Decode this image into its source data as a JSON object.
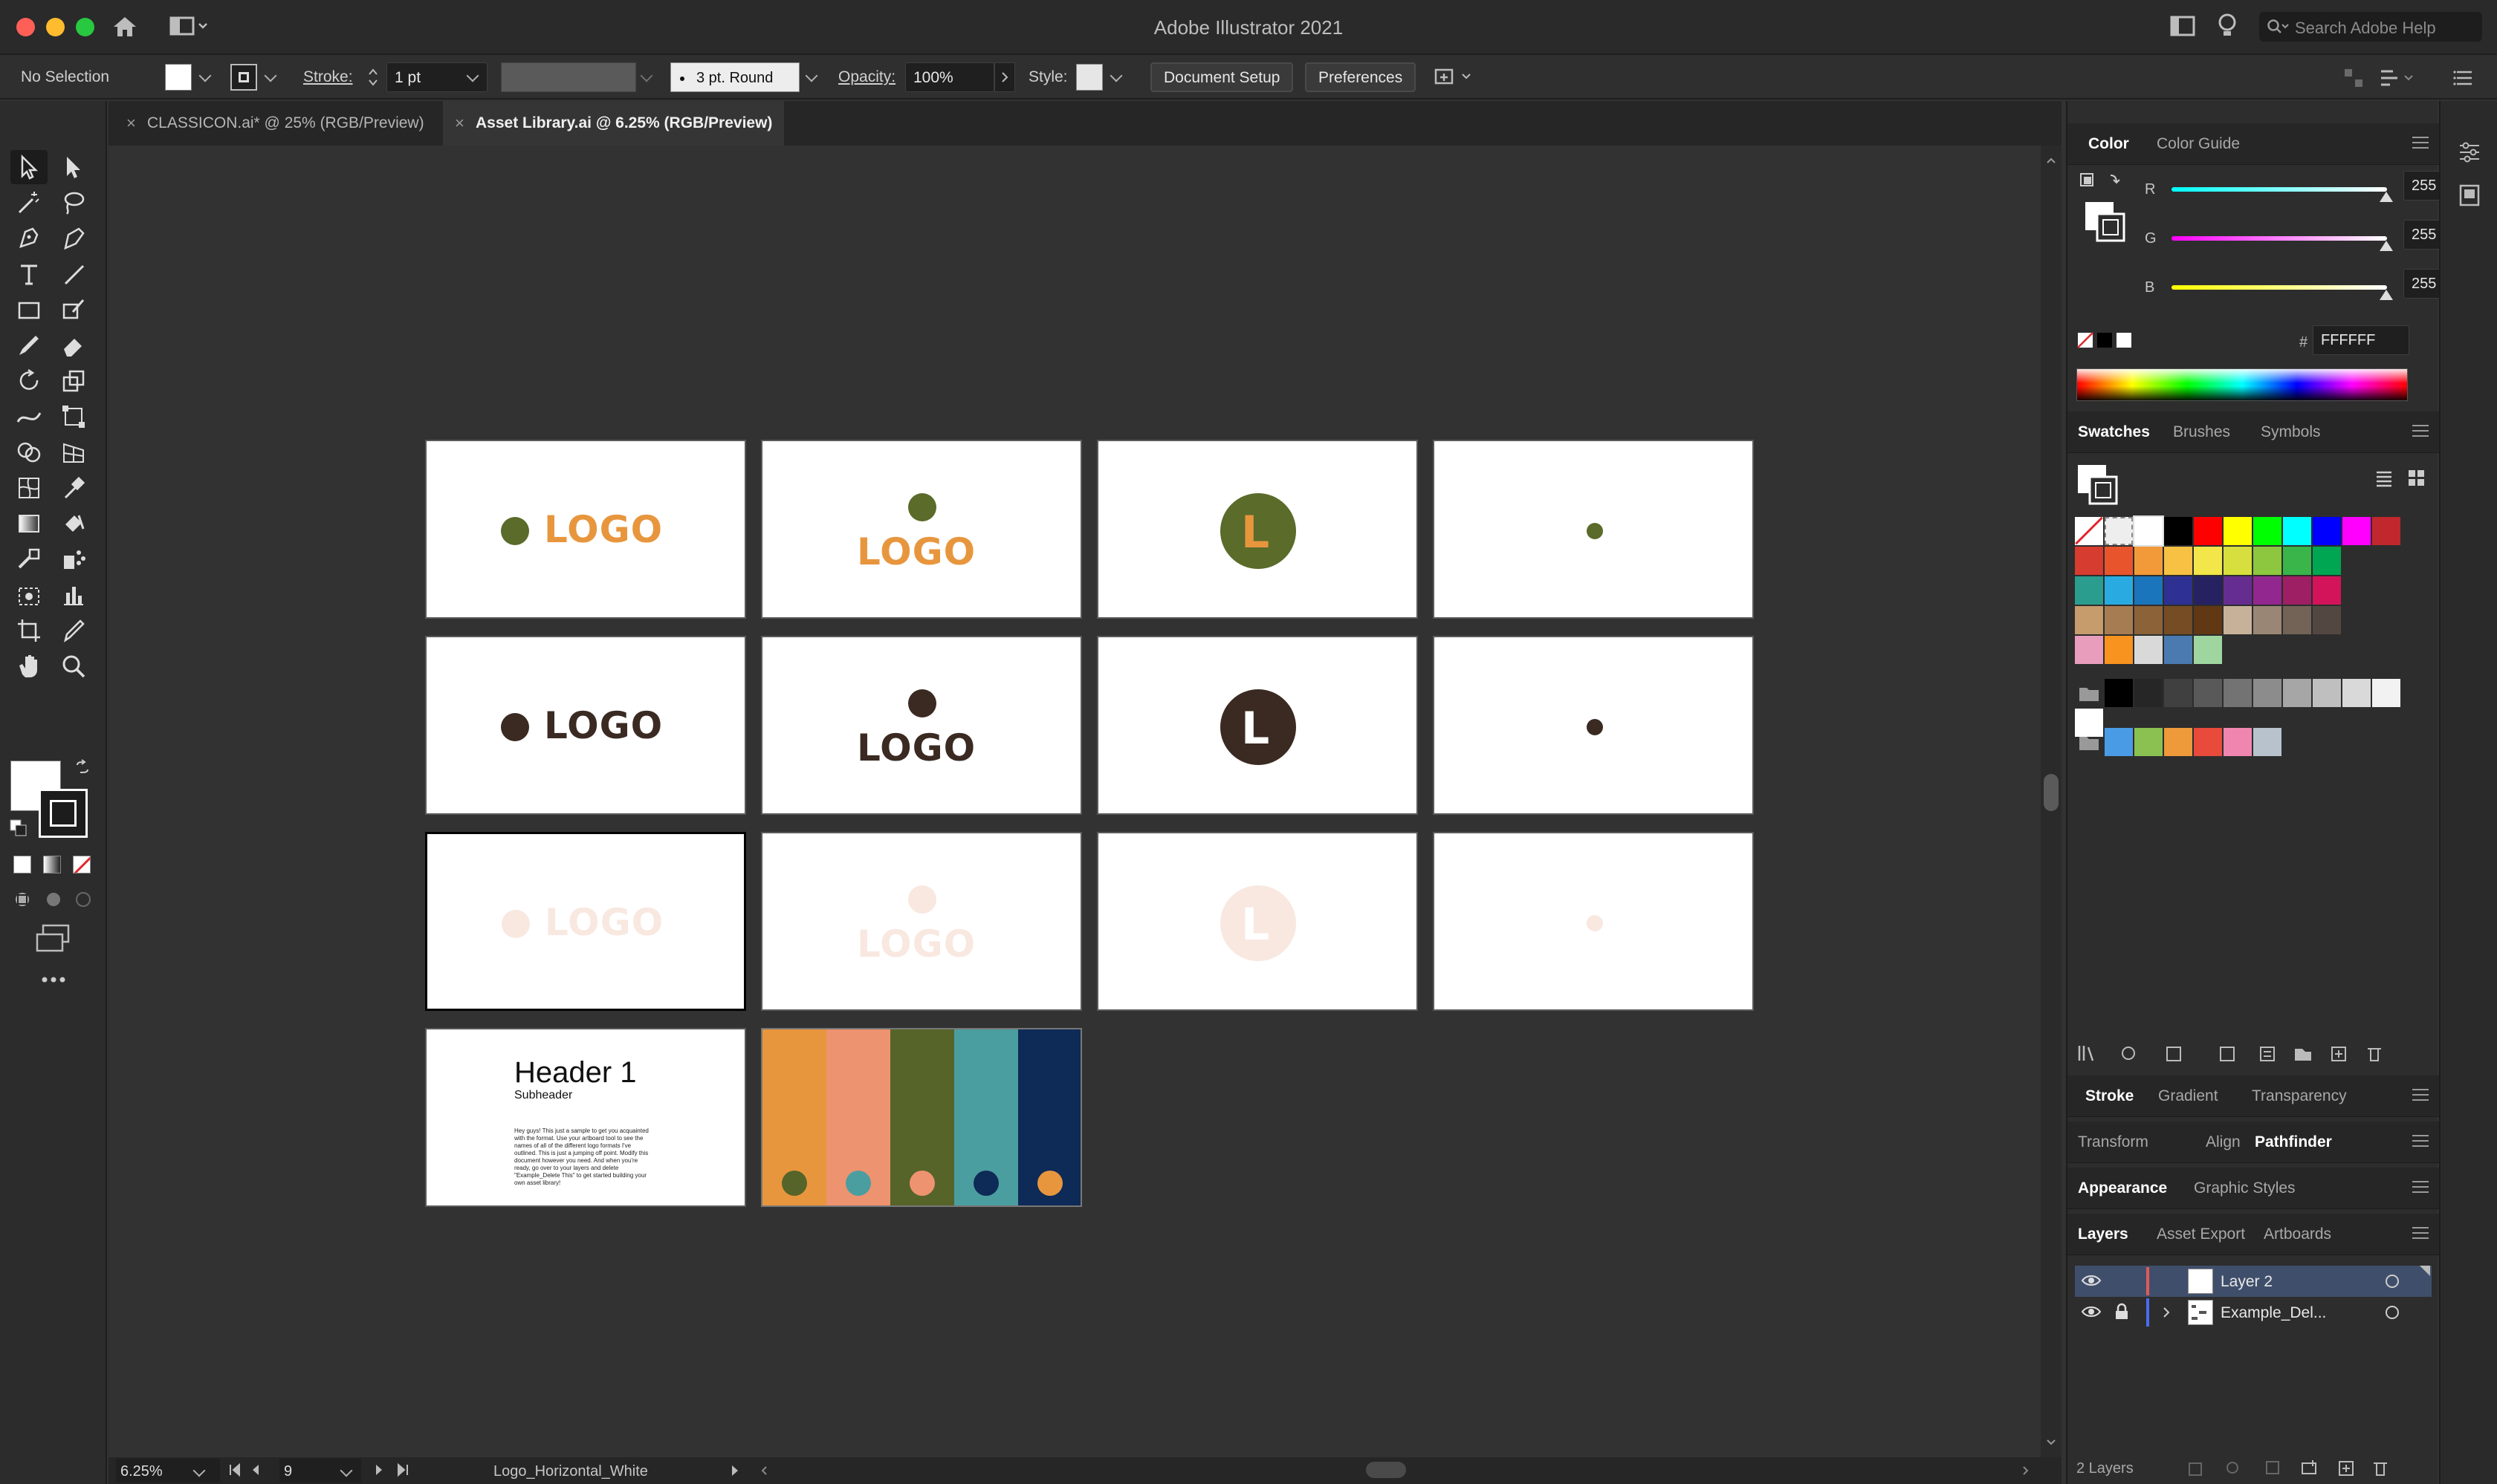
{
  "window": {
    "title": "Adobe Illustrator 2021",
    "search_placeholder": "Search Adobe Help"
  },
  "control_bar": {
    "selection": "No Selection",
    "stroke_label": "Stroke:",
    "stroke_weight": "1 pt",
    "brush": "3 pt. Round",
    "opacity_label": "Opacity:",
    "opacity": "100%",
    "style_label": "Style:",
    "document_setup": "Document Setup",
    "preferences": "Preferences"
  },
  "tabs": [
    {
      "label": "CLASSICON.ai* @ 25% (RGB/Preview)",
      "active": false
    },
    {
      "label": "Asset Library.ai @ 6.25% (RGB/Preview)",
      "active": true
    }
  ],
  "artboards": {
    "logo_text": "LOGO",
    "mark_letter": "L",
    "header_title": "Header 1",
    "subheader": "Subheader",
    "body_text": "Hey guys! This just a sample to get you acquainted with the format. Use your artboard tool to see the names of all of the different logo formats I've outlined. This is just a jumping off point. Modify this document however you need. And when you're ready, go over to your layers and delete \"Example_Delete This\" to get started building your own asset library!"
  },
  "palette": {
    "colors": [
      "#e8963e",
      "#ee9370",
      "#566429",
      "#4b9e9f",
      "#0e2a57"
    ],
    "dots": [
      "#566429",
      "#4b9e9f",
      "#ee9370",
      "#0e2a57",
      "#e8963e"
    ]
  },
  "brand_colors": {
    "olive": "#5a6b2a",
    "orange": "#e8963e",
    "dark_brown": "#3a2a22",
    "pale_peach": "#f8e8e0"
  },
  "status_bar": {
    "zoom": "6.25%",
    "artboard_number": "9",
    "artboard_name": "Logo_Horizontal_White"
  },
  "color_panel": {
    "tabs": [
      "Color",
      "Color Guide"
    ],
    "r_label": "R",
    "g_label": "G",
    "b_label": "B",
    "r": "255",
    "g": "255",
    "b": "255",
    "hex_label": "#",
    "hex": "FFFFFF"
  },
  "swatches_panel": {
    "tabs": [
      "Swatches",
      "Brushes",
      "Symbols"
    ],
    "rows": [
      [
        "#ffffff",
        "#000000",
        "#ff0000",
        "#ffff00",
        "#00ff00",
        "#00ffff",
        "#0000ff",
        "#ff00ff",
        "#c1272d"
      ],
      [
        "#d63c2f",
        "#e8552c",
        "#f29a3a",
        "#f7c244",
        "#f3e64a",
        "#d6df3d",
        "#8dc63f",
        "#39b54a",
        "#00a651"
      ],
      [
        "#2a9d8f",
        "#29abe2",
        "#1b75bc",
        "#2e3192",
        "#262262",
        "#662d91",
        "#92278f",
        "#9e1f63",
        "#d4145a"
      ],
      [
        "#c69c6d",
        "#a67c52",
        "#8c6239",
        "#754c24",
        "#603813",
        "#c7b299",
        "#998675",
        "#736357",
        "#534741"
      ],
      [
        "#e89dbd",
        "#f7931e",
        "#d9d9d9",
        "#4a7ab0",
        "#9fd6a0"
      ],
      [
        "#000000",
        "#262626",
        "#404040",
        "#595959",
        "#737373",
        "#8c8c8c",
        "#a6a6a6",
        "#bfbfbf",
        "#d9d9d9",
        "#f2f2f2"
      ],
      [
        "#4a9be6",
        "#8ac150",
        "#ee9a3a",
        "#e84b3c",
        "#ee86b0",
        "#b8c2cc"
      ]
    ]
  },
  "lower_panels": {
    "row1": [
      "Stroke",
      "Gradient",
      "Transparency"
    ],
    "row2": [
      "Transform",
      "Align",
      "Pathfinder"
    ],
    "row3": [
      "Appearance",
      "Graphic Styles"
    ],
    "row4": [
      "Layers",
      "Asset Export",
      "Artboards"
    ]
  },
  "layers": {
    "items": [
      {
        "name": "Layer 2",
        "color": "#e05a5a"
      },
      {
        "name": "Example_Del...",
        "color": "#4a6cf0"
      }
    ],
    "count": "2 Layers"
  }
}
